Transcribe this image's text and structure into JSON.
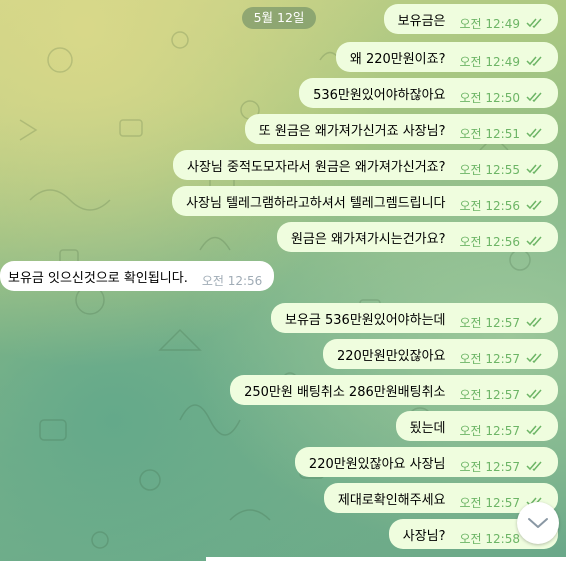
{
  "date_badge": "5월 12일",
  "outgoing_top": [
    {
      "text": "보유금은",
      "time": "오전 12:49"
    },
    {
      "text": "왜 220만원이죠?",
      "time": "오전 12:49"
    },
    {
      "text": "536만원있어야하잖아요",
      "time": "오전 12:50"
    },
    {
      "text": "또 원금은 왜가져가신거죠 사장님?",
      "time": "오전 12:51"
    },
    {
      "text": "사장님 중적도모자라서 원금은 왜가져가신거죠?",
      "time": "오전 12:55"
    },
    {
      "text": "사장님 텔레그램하라고하셔서 텔레그렘드립니다",
      "time": "오전 12:56"
    },
    {
      "text": "원금은 왜가져가시는건가요?",
      "time": "오전 12:56"
    }
  ],
  "incoming": {
    "text": "보유금 잇으신것으로 확인됩니다.",
    "time": "오전 12:56"
  },
  "outgoing_bottom": [
    {
      "text": "보유금 536만원있어야하는데",
      "time": "오전 12:57"
    },
    {
      "text": "220만원만있잖아요",
      "time": "오전 12:57"
    },
    {
      "text": "250만원 배팅취소 286만원배팅취소",
      "time": "오전 12:57"
    },
    {
      "text": "됬는데",
      "time": "오전 12:57"
    },
    {
      "text": "220만원있잖아요 사장님",
      "time": "오전 12:57"
    },
    {
      "text": "제대로확인해주세요",
      "time": "오전 12:57"
    },
    {
      "text": "사장님?",
      "time": "오전 12:58"
    }
  ],
  "colors": {
    "outgoing_bubble": "#effdde",
    "incoming_bubble": "#ffffff",
    "read_ticks": "#6db566",
    "incoming_time": "#a0acb6"
  },
  "icons": {
    "read_status": "double-check-icon",
    "scroll_down": "chevron-down-icon"
  }
}
